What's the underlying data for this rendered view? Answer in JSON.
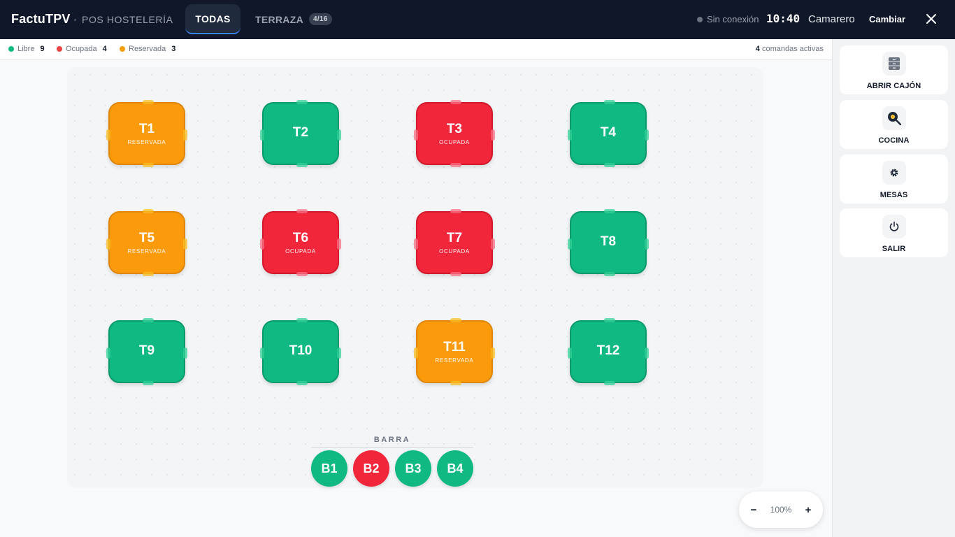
{
  "header": {
    "brand": "FactuTPV",
    "subtitle": "POS HOSTELERÍA",
    "tabs": [
      {
        "label": "TODAS"
      },
      {
        "label": "TERRAZA",
        "badge": "4/16"
      }
    ],
    "connection": "Sin conexión",
    "time": "10:40",
    "user": "Camarero",
    "change_label": "Cambiar",
    "close_icon": "close-icon"
  },
  "status": {
    "legend": [
      {
        "label": "Libre",
        "count": "9",
        "color": "#10b981"
      },
      {
        "label": "Ocupada",
        "count": "4",
        "color": "#ef4444"
      },
      {
        "label": "Reservada",
        "count": "3",
        "color": "#f59e0b"
      }
    ],
    "orders_count": "4",
    "orders_label": "comandas activas"
  },
  "tables": [
    {
      "name": "T1",
      "state": "reservada",
      "label": "RESERVADA"
    },
    {
      "name": "T2",
      "state": "libre",
      "label": ""
    },
    {
      "name": "T3",
      "state": "ocupada",
      "label": "OCUPADA"
    },
    {
      "name": "T4",
      "state": "libre",
      "label": ""
    },
    {
      "name": "T5",
      "state": "reservada",
      "label": "RESERVADA"
    },
    {
      "name": "T6",
      "state": "ocupada",
      "label": "OCUPADA"
    },
    {
      "name": "T7",
      "state": "ocupada",
      "label": "OCUPADA"
    },
    {
      "name": "T8",
      "state": "libre",
      "label": ""
    },
    {
      "name": "T9",
      "state": "libre",
      "label": ""
    },
    {
      "name": "T10",
      "state": "libre",
      "label": ""
    },
    {
      "name": "T11",
      "state": "reservada",
      "label": "RESERVADA"
    },
    {
      "name": "T12",
      "state": "libre",
      "label": ""
    }
  ],
  "bar": {
    "label": "BARRA",
    "stools": [
      {
        "name": "B1",
        "state": "libre"
      },
      {
        "name": "B2",
        "state": "ocupada"
      },
      {
        "name": "B3",
        "state": "libre"
      },
      {
        "name": "B4",
        "state": "libre"
      }
    ]
  },
  "zoom": {
    "minus": "−",
    "value": "100%",
    "plus": "+"
  },
  "sidebar": {
    "actions": [
      {
        "label": "ABRIR CAJÓN",
        "icon": "cabinet-icon"
      },
      {
        "label": "COCINA",
        "icon": "frying-pan-icon"
      },
      {
        "label": "MESAS",
        "icon": "gear-icon"
      },
      {
        "label": "SALIR",
        "icon": "power-icon"
      }
    ]
  },
  "colors": {
    "libre": "#10b981",
    "ocupada": "#f2263a",
    "reservada": "#fb9b0b",
    "header_bg": "#0f1729"
  }
}
